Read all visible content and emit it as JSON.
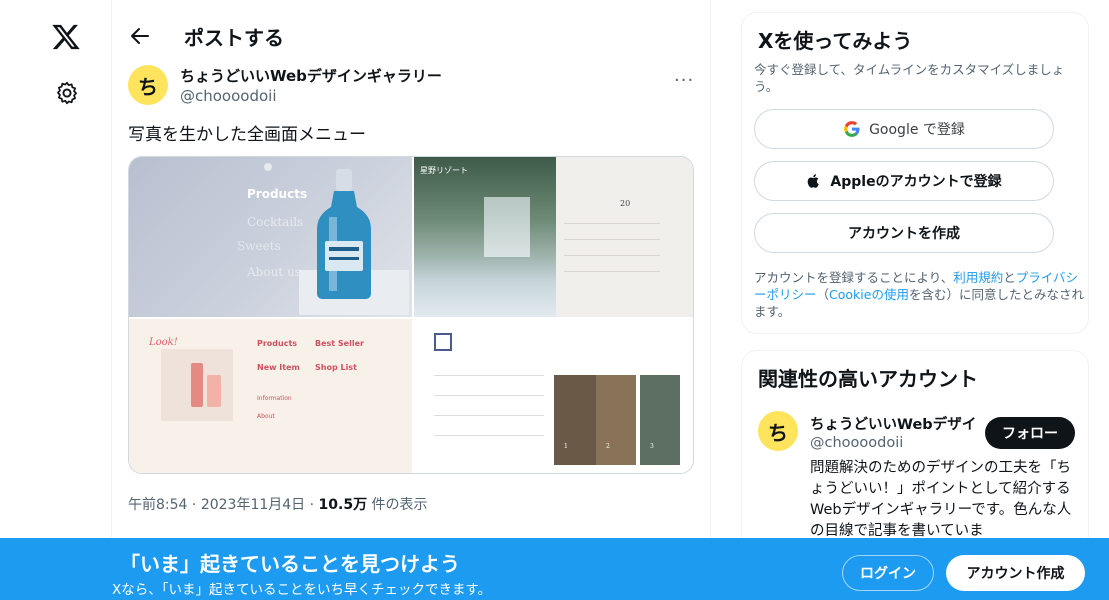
{
  "header": {
    "title": "ポストする"
  },
  "post": {
    "author_name": "ちょうどいいWebデザインギャラリー",
    "author_handle": "@choooodoii",
    "avatar_glyph": "ち",
    "more_label": "···",
    "text": "写真を生かした全画面メニュー",
    "time": "午前8:54",
    "sep1": "·",
    "date": "2023年11月4日",
    "sep2": "·",
    "views": "10.5万",
    "views_label": "件の表示",
    "media": {
      "tile1": {
        "heading": "Products",
        "items": [
          "Cocktails",
          "Sweets",
          "About us"
        ]
      },
      "tile2": {
        "title": "星野リゾート",
        "number": "20"
      },
      "tile3": {
        "items_left": [
          "Products",
          "New Item",
          "Information",
          "About"
        ],
        "items_right": [
          "Best Seller",
          "Shop List"
        ],
        "script": "Look!"
      },
      "tile4": {
        "cards": [
          "1",
          "2",
          "3"
        ]
      }
    }
  },
  "signup": {
    "title": "Xを使ってみよう",
    "subtitle": "今すぐ登録して、タイムラインをカスタマイズしましょう。",
    "google_label": "Google で登録",
    "apple_label": "Appleのアカウントで登録",
    "create_label": "アカウントを作成",
    "legal_pre": "アカウントを登録することにより、",
    "legal_terms": "利用規約",
    "legal_and": "と",
    "legal_privacy": "プライバシーポリシー",
    "legal_paren_open": "（",
    "legal_cookie": "Cookieの使用",
    "legal_post": "を含む）に同意したとみなされます。"
  },
  "related": {
    "title": "関連性の高いアカウント",
    "name": "ちょうどいいWebデザイ",
    "handle": "@choooodoii",
    "avatar_glyph": "ち",
    "follow_label": "フォロー",
    "bio": "問題解決のためのデザインの工夫を「ちょうどいい！」ポイントとして紹介するWebデザインギャラリーです。色んな人の目線で記事を書いていま"
  },
  "banner": {
    "title": "「いま」起きていることを見つけよう",
    "subtitle": "Xなら、「いま」起きていることをいち早くチェックできます。",
    "login_label": "ログイン",
    "create_label": "アカウント作成"
  },
  "colors": {
    "accent": "#1d9bf0",
    "text": "#0f1419",
    "muted": "#536471",
    "avatar_bg": "#fde45c"
  }
}
